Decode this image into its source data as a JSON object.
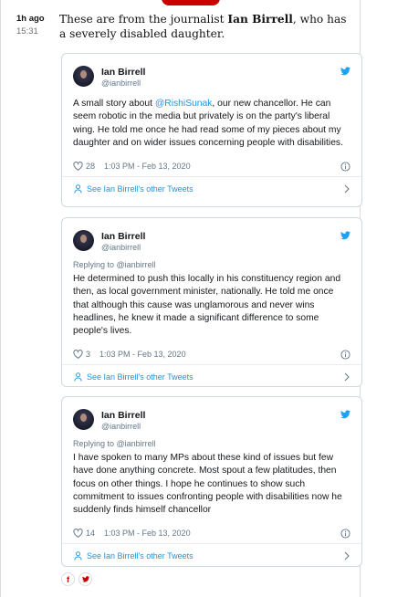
{
  "entry": {
    "time_relative": "1h ago",
    "time_absolute": "15:31",
    "intro_before": "These are from the journalist ",
    "intro_name": "Ian Birrell",
    "intro_after": ", who has a severely disabled daughter."
  },
  "tweets": [
    {
      "name": "Ian Birrell",
      "handle": "@ianbirrell",
      "reply_to": "",
      "text_pre": "A small story about ",
      "mention": "@RishiSunak",
      "text_post": ", our new chancellor. He can seem robotic in the media but privately is on the party's liberal wing. He told me once he had read some of my pieces about my daughter and on wider issues concerning people with disabilities.",
      "likes": "28",
      "timestamp": "1:03 PM - Feb 13, 2020",
      "footer": "See Ian Birrell's other Tweets"
    },
    {
      "name": "Ian Birrell",
      "handle": "@ianbirrell",
      "reply_to": "Replying to @ianbirrell",
      "text_pre": "He determined to push this locally in his constituency region and then, as local government minister, nationally. He told me once that although this cause was unglamorous and never wins headlines, he knew it made a significant difference to some people's lives.",
      "mention": "",
      "text_post": "",
      "likes": "3",
      "timestamp": "1:03 PM - Feb 13, 2020",
      "footer": "See Ian Birrell's other Tweets"
    },
    {
      "name": "Ian Birrell",
      "handle": "@ianbirrell",
      "reply_to": "Replying to @ianbirrell",
      "text_pre": "I have spoken to many MPs about these kind of issues but few have done anything concrete. Most spout a few platitudes, then focus on other things. I hope he continues to show such commitment to issues confronting people with disabilities now he suddenly finds himself chancellor",
      "mention": "",
      "text_post": "",
      "likes": "14",
      "timestamp": "1:03 PM - Feb 13, 2020",
      "footer": "See Ian Birrell's other Tweets"
    }
  ],
  "share": {
    "facebook_glyph": "f",
    "twitter_glyph": "t"
  },
  "colors": {
    "guardian_red": "#c70000",
    "twitter_blue": "#1da1f2",
    "link_blue": "#1b95e0",
    "muted": "#657786"
  }
}
